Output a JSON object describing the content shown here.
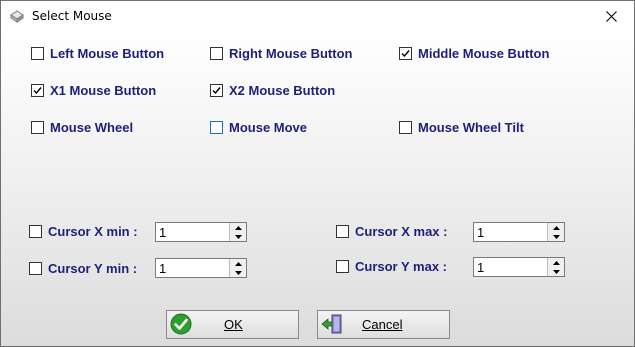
{
  "window": {
    "title": "Select Mouse",
    "icons": {
      "app": "mouse-app-icon",
      "close": "close-icon"
    }
  },
  "buttons_section": {
    "left_mouse_button": {
      "label": "Left Mouse Button",
      "checked": false
    },
    "right_mouse_button": {
      "label": "Right Mouse Button",
      "checked": false
    },
    "middle_mouse_button": {
      "label": "Middle Mouse Button",
      "checked": true
    },
    "x1_mouse_button": {
      "label": "X1 Mouse Button",
      "checked": true
    },
    "x2_mouse_button": {
      "label": "X2 Mouse Button",
      "checked": true
    },
    "mouse_wheel": {
      "label": "Mouse Wheel",
      "checked": false
    },
    "mouse_move": {
      "label": "Mouse Move",
      "checked": false
    },
    "mouse_wheel_tilt": {
      "label": "Mouse Wheel Tilt",
      "checked": false
    }
  },
  "cursor_limits": {
    "x_min": {
      "label": "Cursor X min :",
      "value": "1",
      "checked": false
    },
    "y_min": {
      "label": "Cursor Y min :",
      "value": "1",
      "checked": false
    },
    "x_max": {
      "label": "Cursor X max :",
      "value": "1",
      "checked": false
    },
    "y_max": {
      "label": "Cursor Y max :",
      "value": "1",
      "checked": false
    }
  },
  "actions": {
    "ok": {
      "label": "OK",
      "icon": "green-checkmark-icon"
    },
    "cancel": {
      "label": "Cancel",
      "icon": "exit-door-icon"
    }
  },
  "colors": {
    "label_text": "#1f1f7a",
    "focus_checkbox_border": "#1e6fbf",
    "ok_icon_green": "#2e9e2e"
  }
}
